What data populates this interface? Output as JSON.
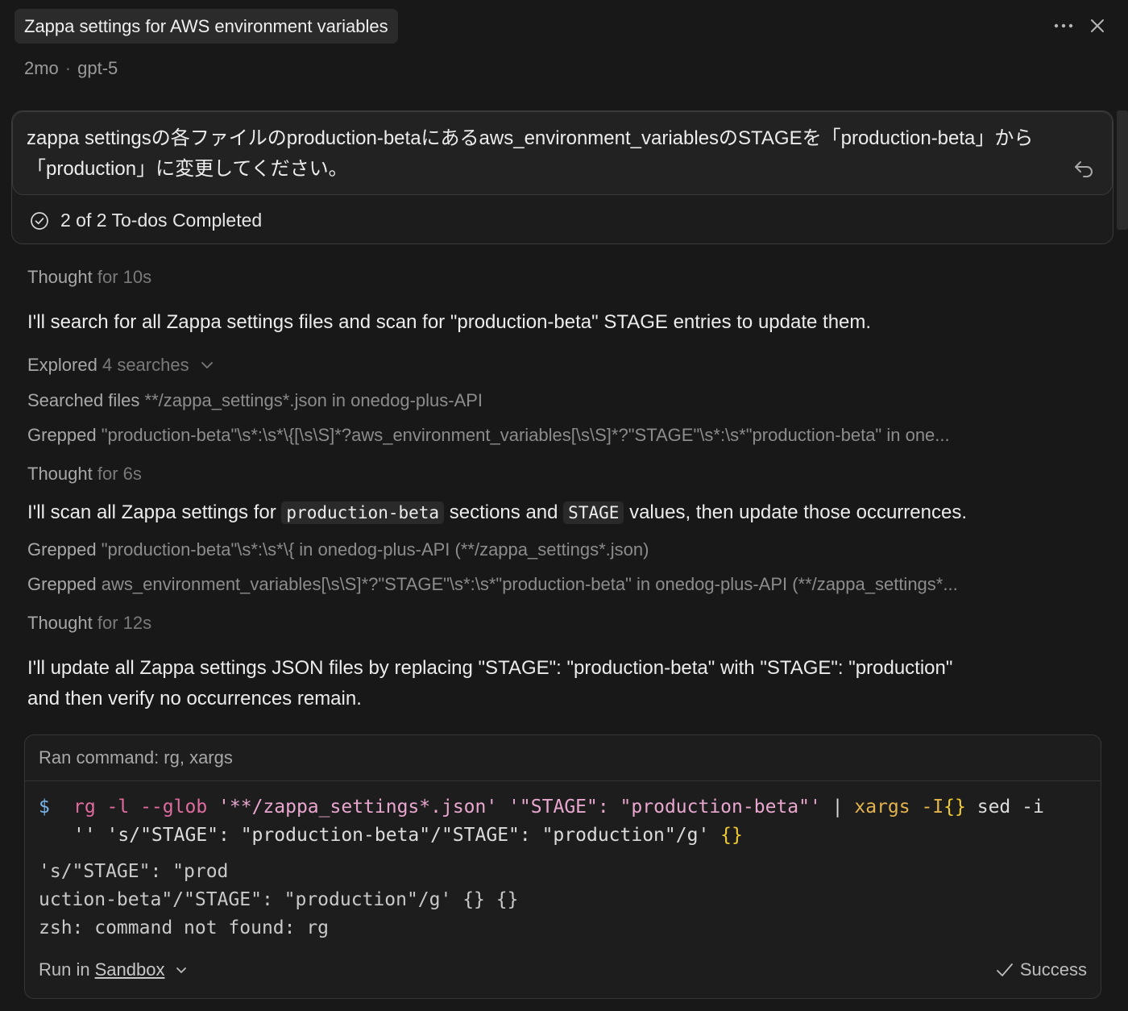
{
  "header": {
    "title": "Zappa settings for AWS environment variables",
    "age": "2mo",
    "separator": "·",
    "model": "gpt-5",
    "more_icon": "ellipsis-icon",
    "close_icon": "close-icon"
  },
  "prompt": {
    "text": "zappa settingsの各ファイルのproduction-betaにあるaws_environment_variablesのSTAGEを「production-beta」から「production」に変更してください。",
    "todos": "2 of 2 To-dos Completed"
  },
  "transcript": {
    "thought1": {
      "label": "Thought",
      "duration": "for 10s"
    },
    "para1": "I'll search for all Zappa settings files and scan for \"production-beta\" STAGE entries to update them.",
    "explored": {
      "label": "Explored",
      "detail": "4 searches"
    },
    "tool1": {
      "verb": "Searched files",
      "detail": "**/zappa_settings*.json in onedog-plus-API"
    },
    "tool2": {
      "verb": "Grepped",
      "detail": "\"production-beta\"\\s*:\\s*\\{[\\s\\S]*?aws_environment_variables[\\s\\S]*?\"STAGE\"\\s*:\\s*\"production-beta\" in one..."
    },
    "thought2": {
      "label": "Thought",
      "duration": "for 6s"
    },
    "para2": {
      "before": "I'll scan all Zappa settings for",
      "code1": "production-beta",
      "middle": "sections and",
      "code2": "STAGE",
      "after": "values, then update those occurrences."
    },
    "tool3": {
      "verb": "Grepped",
      "detail": "\"production-beta\"\\s*:\\s*\\{ in onedog-plus-API (**/zappa_settings*.json)"
    },
    "tool4": {
      "verb": "Grepped",
      "detail": "aws_environment_variables[\\s\\S]*?\"STAGE\"\\s*:\\s*\"production-beta\" in onedog-plus-API (**/zappa_settings*..."
    },
    "thought3": {
      "label": "Thought",
      "duration": "for 12s"
    },
    "para3_line1": "I'll update all Zappa settings JSON files by replacing \"STAGE\": \"production-beta\" with \"STAGE\": \"production\"",
    "para3_line2": "and then verify no occurrences remain."
  },
  "command": {
    "title": "Ran command: rg, xargs",
    "prompt_symbol": "$",
    "line1": {
      "cmd": "rg -l --glob",
      "glob": "'**/zappa_settings*.json'",
      "pattern": "'\"STAGE\": \"production-beta\"'",
      "pipe": "|",
      "xargs": "xargs -I",
      "brace": "{}",
      "rest": "sed -i"
    },
    "line2": {
      "text": "'' 's/\"STAGE\": \"production-beta\"/\"STAGE\": \"production\"/g'",
      "brace": "{}"
    },
    "output": [
      "'s/\"STAGE\": \"prod",
      "uction-beta\"/\"STAGE\": \"production\"/g' {} {}",
      "zsh: command not found: rg"
    ],
    "run_in_label": "Run in",
    "run_in_value": "Sandbox",
    "status": "Success"
  }
}
